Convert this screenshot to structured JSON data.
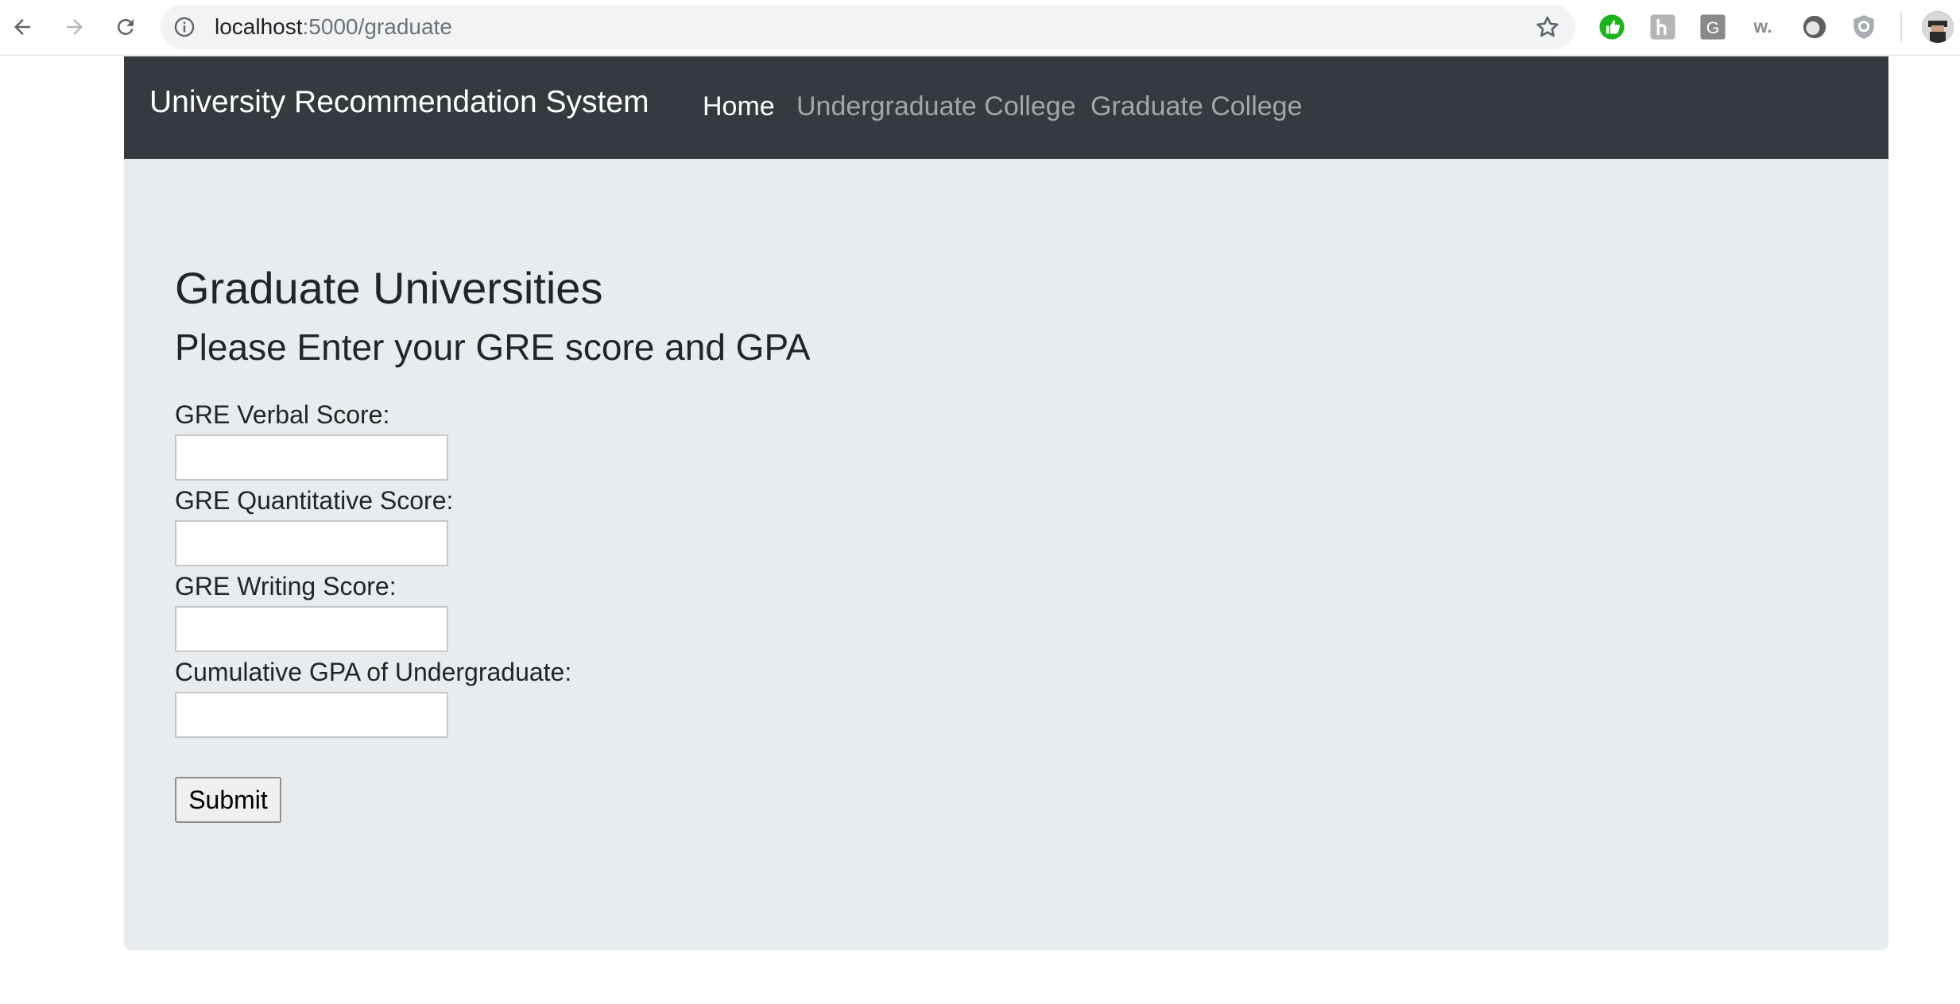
{
  "browser": {
    "url_host": "localhost",
    "url_path": ":5000/graduate",
    "icons": {
      "back": "arrow-left-icon",
      "forward": "arrow-right-icon",
      "reload": "reload-icon",
      "info": "info-icon",
      "bookmark": "star-icon"
    },
    "extensions": [
      {
        "name": "thumbs-up-extension",
        "glyph": "👍",
        "color": "#1db31d"
      },
      {
        "name": "h-extension",
        "glyph": "h",
        "color": "#b5b5b5"
      },
      {
        "name": "grammarly-extension",
        "glyph": "G",
        "color": "#8a8a8a"
      },
      {
        "name": "w-extension",
        "glyph": "w.",
        "color": "#8a8a8a"
      },
      {
        "name": "circle-extension",
        "glyph": "",
        "color": "#5f5f5f"
      },
      {
        "name": "shield-extension",
        "glyph": "",
        "color": "#a9adb2"
      }
    ]
  },
  "navbar": {
    "brand": "University Recommendation System",
    "links": [
      {
        "label": "Home",
        "active": true
      },
      {
        "label": "Undergraduate College",
        "active": false
      },
      {
        "label": "Graduate College",
        "active": false
      }
    ],
    "bg_color": "#343a40"
  },
  "main": {
    "title": "Graduate Universities",
    "subtitle": "Please Enter your GRE score and GPA",
    "fields": [
      {
        "label": "GRE Verbal Score:",
        "value": ""
      },
      {
        "label": "GRE Quantitative Score:",
        "value": ""
      },
      {
        "label": "GRE Writing Score:",
        "value": ""
      },
      {
        "label": "Cumulative GPA of Undergraduate:",
        "value": ""
      }
    ],
    "submit_label": "Submit",
    "bg_color": "#e9ecef"
  }
}
